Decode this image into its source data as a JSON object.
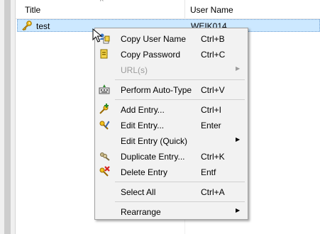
{
  "list": {
    "columns": {
      "title": "Title",
      "user_name": "User Name"
    },
    "rows": [
      {
        "title": "test",
        "user_name": "WEIK014",
        "icon": "key-icon"
      }
    ]
  },
  "context_menu": {
    "items": [
      {
        "label": "Copy User Name",
        "shortcut": "Ctrl+B",
        "icon": "copy-user-icon"
      },
      {
        "label": "Copy Password",
        "shortcut": "Ctrl+C",
        "icon": "copy-password-icon"
      },
      {
        "label": "URL(s)",
        "shortcut": "",
        "icon": "",
        "submenu": true,
        "disabled": true
      },
      {
        "label": "Perform Auto-Type",
        "shortcut": "Ctrl+V",
        "icon": "auto-type-icon"
      },
      {
        "label": "Add Entry...",
        "shortcut": "Ctrl+I",
        "icon": "add-entry-icon"
      },
      {
        "label": "Edit Entry...",
        "shortcut": "Enter",
        "icon": "edit-entry-icon"
      },
      {
        "label": "Edit Entry (Quick)",
        "shortcut": "",
        "icon": "",
        "submenu": true
      },
      {
        "label": "Duplicate Entry...",
        "shortcut": "Ctrl+K",
        "icon": "duplicate-entry-icon"
      },
      {
        "label": "Delete Entry",
        "shortcut": "Entf",
        "icon": "delete-entry-icon"
      },
      {
        "label": "Select All",
        "shortcut": "Ctrl+A",
        "icon": ""
      },
      {
        "label": "Rearrange",
        "shortcut": "",
        "icon": "",
        "submenu": true
      }
    ]
  },
  "colors": {
    "selection": "#cce8ff",
    "menu_bg": "#f2f2f2",
    "disabled_text": "#9b9b9b"
  }
}
